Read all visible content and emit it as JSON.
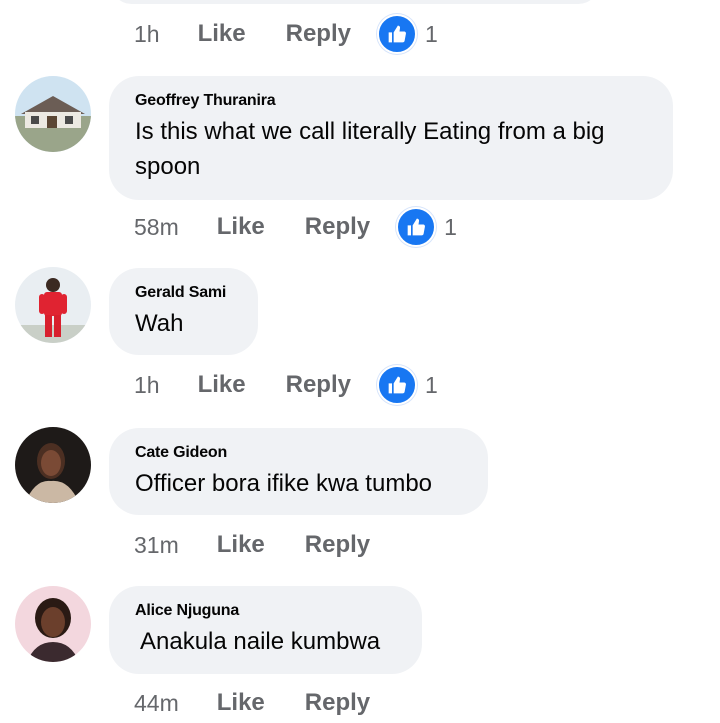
{
  "top_comment": {
    "time": "1h",
    "like_label": "Like",
    "reply_label": "Reply",
    "reaction_count": "1"
  },
  "comments": [
    {
      "author": "Geoffrey Thuranira",
      "text": "Is this what we call literally Eating from  a big spoon",
      "time": "58m",
      "like_label": "Like",
      "reply_label": "Reply",
      "reaction_count": "1"
    },
    {
      "author": "Gerald Sami",
      "text": "Wah",
      "time": "1h",
      "like_label": "Like",
      "reply_label": "Reply",
      "reaction_count": "1"
    },
    {
      "author": "Cate Gideon",
      "text": "Officer bora ifike kwa tumbo",
      "time": "31m",
      "like_label": "Like",
      "reply_label": "Reply"
    },
    {
      "author": "Alice Njuguna",
      "text": "Anakula naile kumbwa",
      "time": "44m",
      "like_label": "Like",
      "reply_label": "Reply"
    }
  ],
  "colors": {
    "bubble": "#f0f2f5",
    "secondary_text": "#65676b",
    "like_blue": "#1877f2"
  },
  "icons": {
    "reaction": "thumbs-up-icon"
  }
}
